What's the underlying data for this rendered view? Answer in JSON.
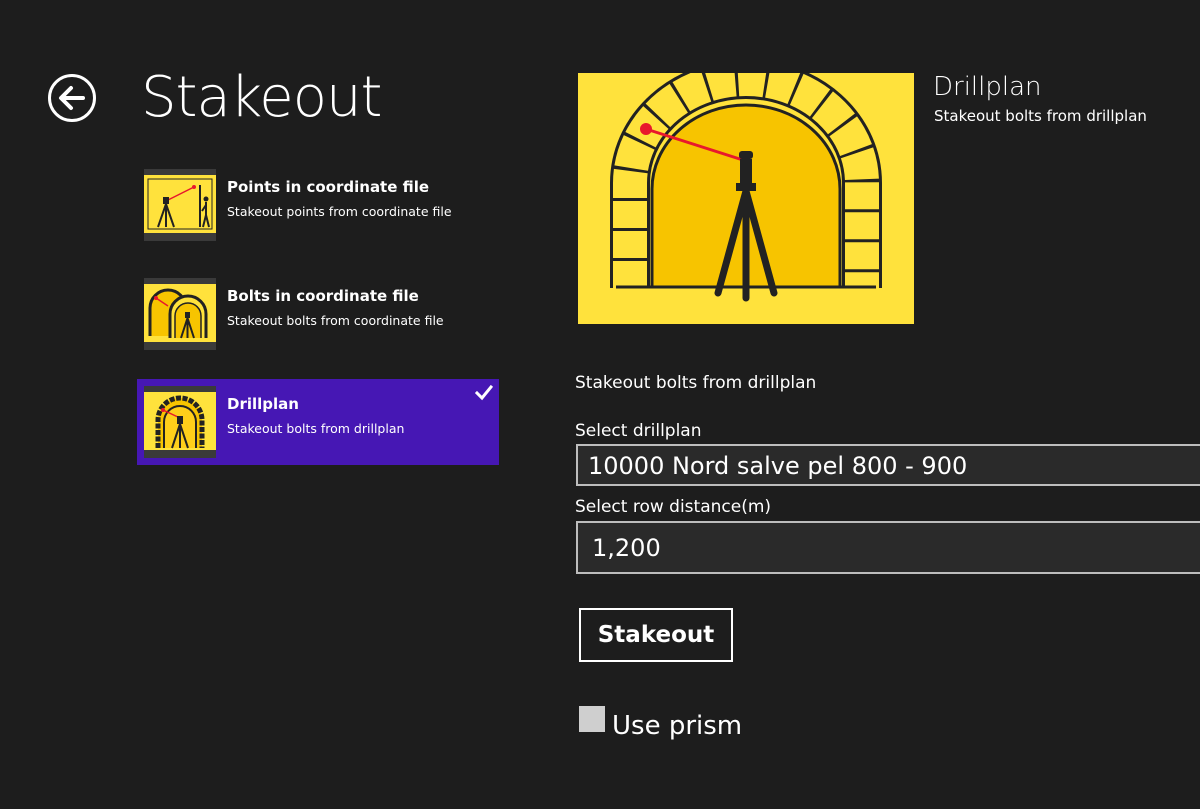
{
  "header": {
    "back_icon": "back-arrow-icon",
    "title": "Stakeout"
  },
  "methods": [
    {
      "title": "Points in coordinate file",
      "subtitle": "Stakeout points from coordinate file",
      "icon": "point-stakeout-icon",
      "selected": false
    },
    {
      "title": "Bolts in coordinate file",
      "subtitle": "Stakeout bolts from coordinate file",
      "icon": "bolts-tunnel-icon",
      "selected": false
    },
    {
      "title": "Drillplan",
      "subtitle": "Stakeout bolts from drillplan",
      "icon": "drillplan-tunnel-icon",
      "selected": true
    }
  ],
  "detail": {
    "title": "Drillplan",
    "subtitle": "Stakeout bolts from drillplan",
    "description": "Stakeout bolts from drillplan",
    "image_icon": "drillplan-tunnel-icon",
    "drillplan_label": "Select drillplan",
    "drillplan_value": "10000 Nord salve pel 800 - 900",
    "row_distance_label": "Select row distance(m)",
    "row_distance_value": "1,200",
    "stakeout_button": "Stakeout",
    "use_prism_label": "Use prism",
    "use_prism_checked": false
  },
  "colors": {
    "background": "#1d1d1d",
    "selected_item": "#4617b4",
    "tunnel_yellow": "#ffe23c",
    "tunnel_inner": "#f7c400",
    "laser_red": "#e8182c"
  }
}
